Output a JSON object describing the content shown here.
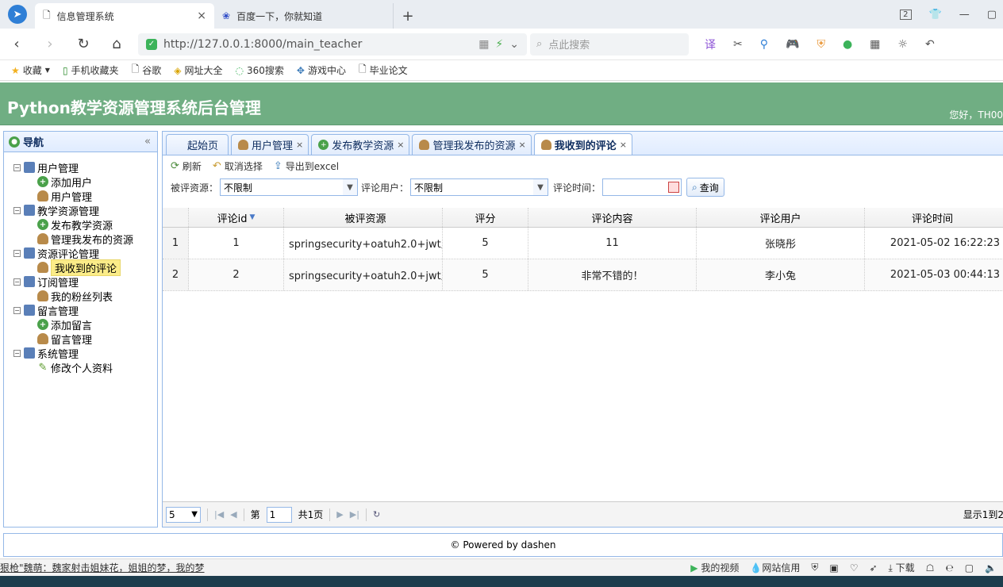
{
  "browser": {
    "tabs": [
      {
        "title": "信息管理系统",
        "active": true
      },
      {
        "title": "百度一下，你就知道",
        "active": false
      }
    ],
    "url": "http://127.0.0.1:8000/main_teacher",
    "search_placeholder": "点此搜索",
    "window_badge": "2",
    "bookmarks": [
      "收藏",
      "手机收藏夹",
      "谷歌",
      "网址大全",
      "360搜索",
      "游戏中心",
      "毕业论文"
    ]
  },
  "app": {
    "title": "Python教学资源管理系统后台管理",
    "greeting": "您好，TH00",
    "footer": "© Powered by dashen"
  },
  "nav": {
    "header": "导航",
    "groups": [
      {
        "label": "用户管理",
        "items": [
          "添加用户",
          "用户管理"
        ]
      },
      {
        "label": "教学资源管理",
        "items": [
          "发布教学资源",
          "管理我发布的资源"
        ]
      },
      {
        "label": "资源评论管理",
        "items": [
          "我收到的评论"
        ]
      },
      {
        "label": "订阅管理",
        "items": [
          "我的粉丝列表"
        ]
      },
      {
        "label": "留言管理",
        "items": [
          "添加留言",
          "留言管理"
        ]
      },
      {
        "label": "系统管理",
        "items": [
          "修改个人资料"
        ]
      }
    ],
    "selected": "我收到的评论"
  },
  "content_tabs": [
    {
      "label": "起始页",
      "closable": false
    },
    {
      "label": "用户管理",
      "closable": true
    },
    {
      "label": "发布教学资源",
      "closable": true
    },
    {
      "label": "管理我发布的资源",
      "closable": true
    },
    {
      "label": "我收到的评论",
      "closable": true,
      "active": true
    }
  ],
  "toolbar": {
    "refresh": "刷新",
    "deselect": "取消选择",
    "export": "导出到excel"
  },
  "filters": {
    "resource_label": "被评资源：",
    "resource_value": "不限制",
    "user_label": "评论用户：",
    "user_value": "不限制",
    "time_label": "评论时间：",
    "query_button": "查询"
  },
  "grid": {
    "columns": [
      "评论id",
      "被评资源",
      "评分",
      "评论内容",
      "评论用户",
      "评论时间"
    ],
    "rows": [
      {
        "num": "1",
        "id": "1",
        "resource": "springsecurity+oatuh2.0+jwt入门",
        "score": "5",
        "content": "11",
        "user": "张晓彤",
        "time": "2021-05-02 16:22:23"
      },
      {
        "num": "2",
        "id": "2",
        "resource": "springsecurity+oatuh2.0+jwt入门",
        "score": "5",
        "content": "非常不错的！",
        "user": "李小兔",
        "time": "2021-05-03 00:44:13"
      }
    ]
  },
  "pager": {
    "page_size": "5",
    "page_prefix": "第",
    "page_value": "1",
    "page_total": "共1页",
    "info": "显示1到2"
  },
  "statusbar": {
    "news": "狠枪\"魏萌：魏家射击姐妹花，姐姐的梦，我的梦",
    "items": [
      "我的视频",
      "网站信用",
      "下载"
    ]
  }
}
